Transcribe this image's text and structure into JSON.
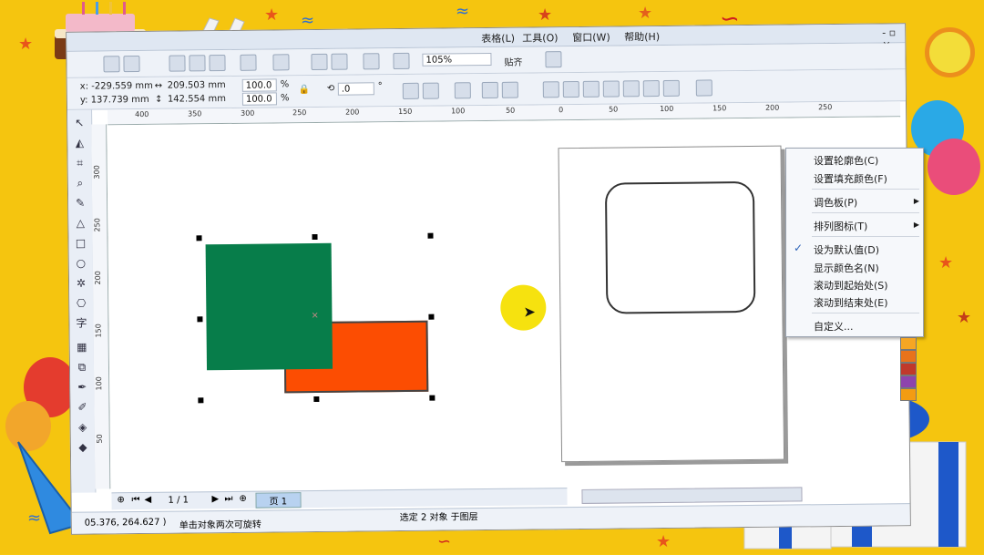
{
  "menubar": {
    "items": [
      "表格(L)",
      "工具(O)",
      "窗口(W)",
      "帮助(H)"
    ]
  },
  "toolbar": {
    "zoom_value": "105%",
    "snap_label": "贴齐"
  },
  "propbar": {
    "x_value": "x: -229.559 mm",
    "y_value": "y: 137.739 mm",
    "width_value": "209.503 mm",
    "height_value": "142.554 mm",
    "scale_x": "100.0",
    "scale_y": "100.0",
    "percent": "%",
    "rotation_value": ".0",
    "degree": "°"
  },
  "ruler_h": [
    "400",
    "350",
    "300",
    "250",
    "200",
    "150",
    "100",
    "50",
    "0",
    "50",
    "100",
    "150",
    "200",
    "250"
  ],
  "ruler_v": [
    "300",
    "250",
    "200",
    "150",
    "100",
    "50"
  ],
  "context_menu": {
    "items": [
      {
        "label": "设置轮廓色(C)",
        "has_submenu": false,
        "checked": false
      },
      {
        "label": "设置填充颜色(F)",
        "has_submenu": false,
        "checked": false
      },
      {
        "label": "调色板(P)",
        "has_submenu": true,
        "checked": false
      },
      {
        "label": "排列图标(T)",
        "has_submenu": true,
        "checked": false
      },
      {
        "label": "设为默认值(D)",
        "has_submenu": false,
        "checked": true
      },
      {
        "label": "显示颜色名(N)",
        "has_submenu": false,
        "checked": false
      },
      {
        "label": "滚动到起始处(S)",
        "has_submenu": false,
        "checked": false
      },
      {
        "label": "滚动到结束处(E)",
        "has_submenu": false,
        "checked": false
      },
      {
        "label": "自定义...",
        "has_submenu": false,
        "checked": false
      }
    ]
  },
  "page_nav": {
    "page_counter": "1 / 1",
    "page_tab": "页 1"
  },
  "statusbar": {
    "coords": "05.376, 264.627 )",
    "hint": "单击对象两次可旋转",
    "selection": "选定 2 对象 于图层"
  },
  "colors": {
    "green_fill": "#077d4a",
    "orange_fill": "#fc4d02",
    "background": "#f5c50f"
  },
  "palette_colors": [
    "#f6a623",
    "#e8731b",
    "#c0392b",
    "#8e44ad",
    "#f39c12"
  ]
}
